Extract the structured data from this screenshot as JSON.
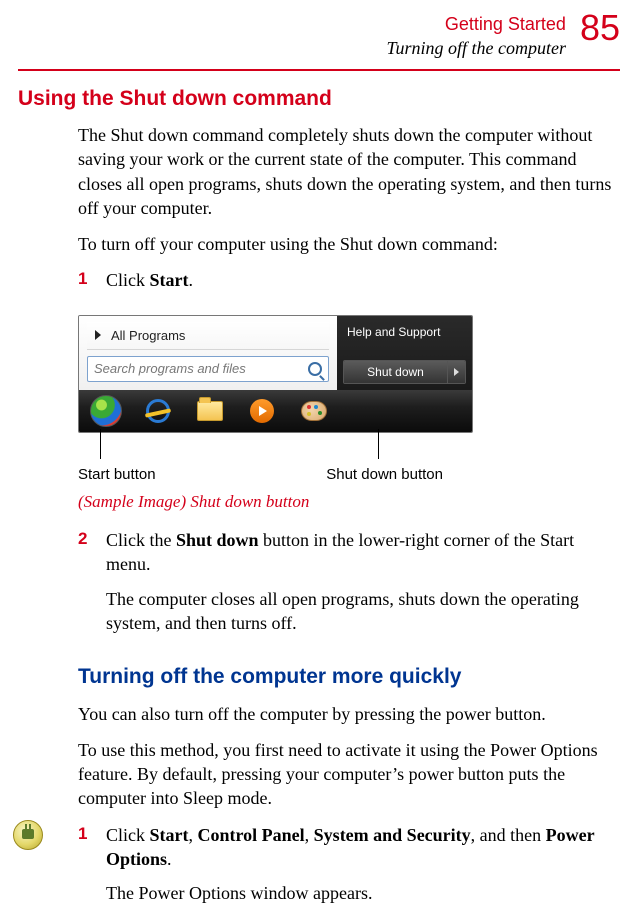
{
  "header": {
    "chapter": "Getting Started",
    "section": "Turning off the computer",
    "page": "85"
  },
  "h2a": "Using the Shut down command",
  "intro1": "The Shut down command completely shuts down the computer without saving your work or the current state of the computer. This command closes all open programs, shuts down the operating system, and then turns off your computer.",
  "intro2": "To turn off your computer using the Shut down command:",
  "step1": {
    "num": "1",
    "pre": "Click ",
    "bold": "Start",
    "post": "."
  },
  "figure": {
    "all_programs": "All Programs",
    "search_placeholder": "Search programs and files",
    "help_support": "Help and Support",
    "shutdown_label": "Shut down",
    "callout_left": "Start button",
    "callout_right": "Shut down button",
    "caption": "(Sample Image) Shut down button"
  },
  "step2": {
    "num": "2",
    "line1_pre": "Click the ",
    "line1_bold": "Shut down",
    "line1_post": " button in the lower-right corner of the Start menu.",
    "line2": "The computer closes all open programs, shuts down the operating system, and then turns off."
  },
  "h2b": "Turning off the computer more quickly",
  "p_quick": "You can also turn off the computer by pressing the power button.",
  "p_method": "To use this method, you first need to activate it using the Power Options feature. By default, pressing your computer’s power button puts the computer into Sleep mode.",
  "step3": {
    "num": "1",
    "pre": "Click ",
    "b1": "Start",
    "sep1": ", ",
    "b2": "Control Panel",
    "sep2": ", ",
    "b3": "System and Security",
    "sep3": ", and then ",
    "b4": "Power Options",
    "post": ".",
    "line2": "The Power Options window appears."
  }
}
